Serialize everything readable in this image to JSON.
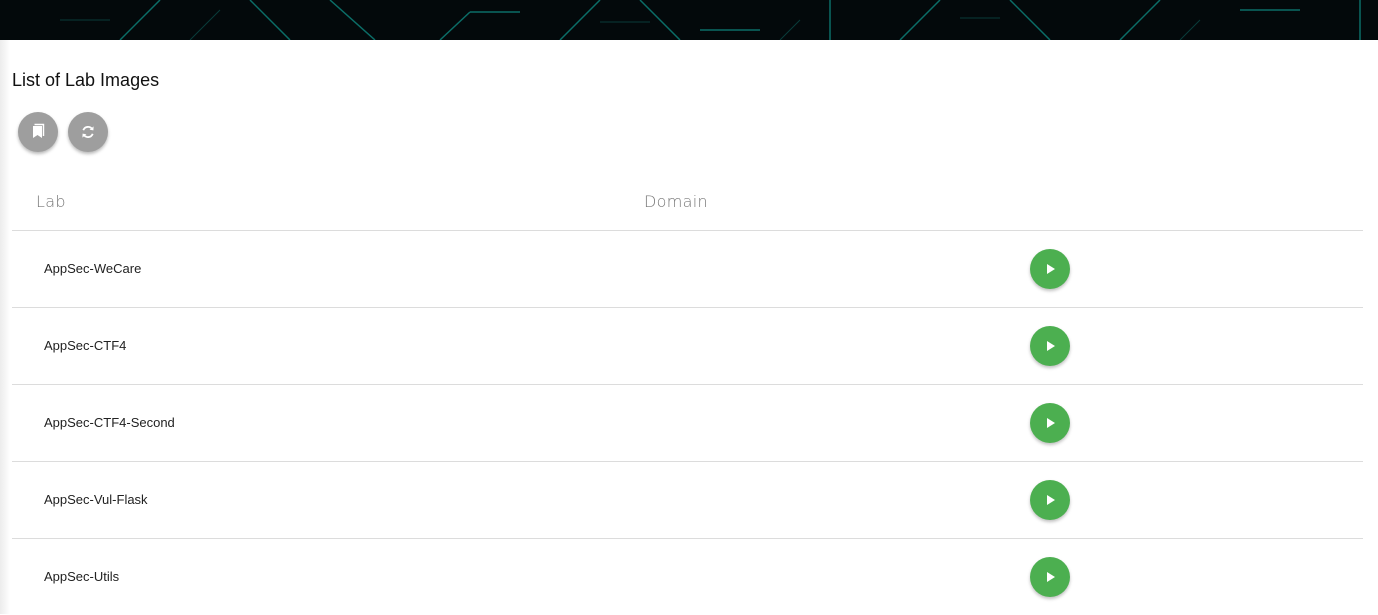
{
  "page": {
    "title": "List of Lab Images"
  },
  "toolbar": {
    "bookmarks_icon": "bookmarks-icon",
    "refresh_icon": "refresh-icon"
  },
  "table": {
    "columns": [
      "Lab",
      "Domain"
    ],
    "rows": [
      {
        "lab": "AppSec-WeCare",
        "domain": "",
        "action_icon": "play-icon"
      },
      {
        "lab": "AppSec-CTF4",
        "domain": "",
        "action_icon": "play-icon"
      },
      {
        "lab": "AppSec-CTF4-Second",
        "domain": "",
        "action_icon": "play-icon"
      },
      {
        "lab": "AppSec-Vul-Flask",
        "domain": "",
        "action_icon": "play-icon"
      },
      {
        "lab": "AppSec-Utils",
        "domain": "",
        "action_icon": "play-icon"
      }
    ]
  },
  "colors": {
    "banner": "#03090b",
    "banner_lines": "#0e8f86",
    "tool_button": "#9e9e9e",
    "play_button": "#4caf50",
    "divider": "#dcdcdc"
  }
}
